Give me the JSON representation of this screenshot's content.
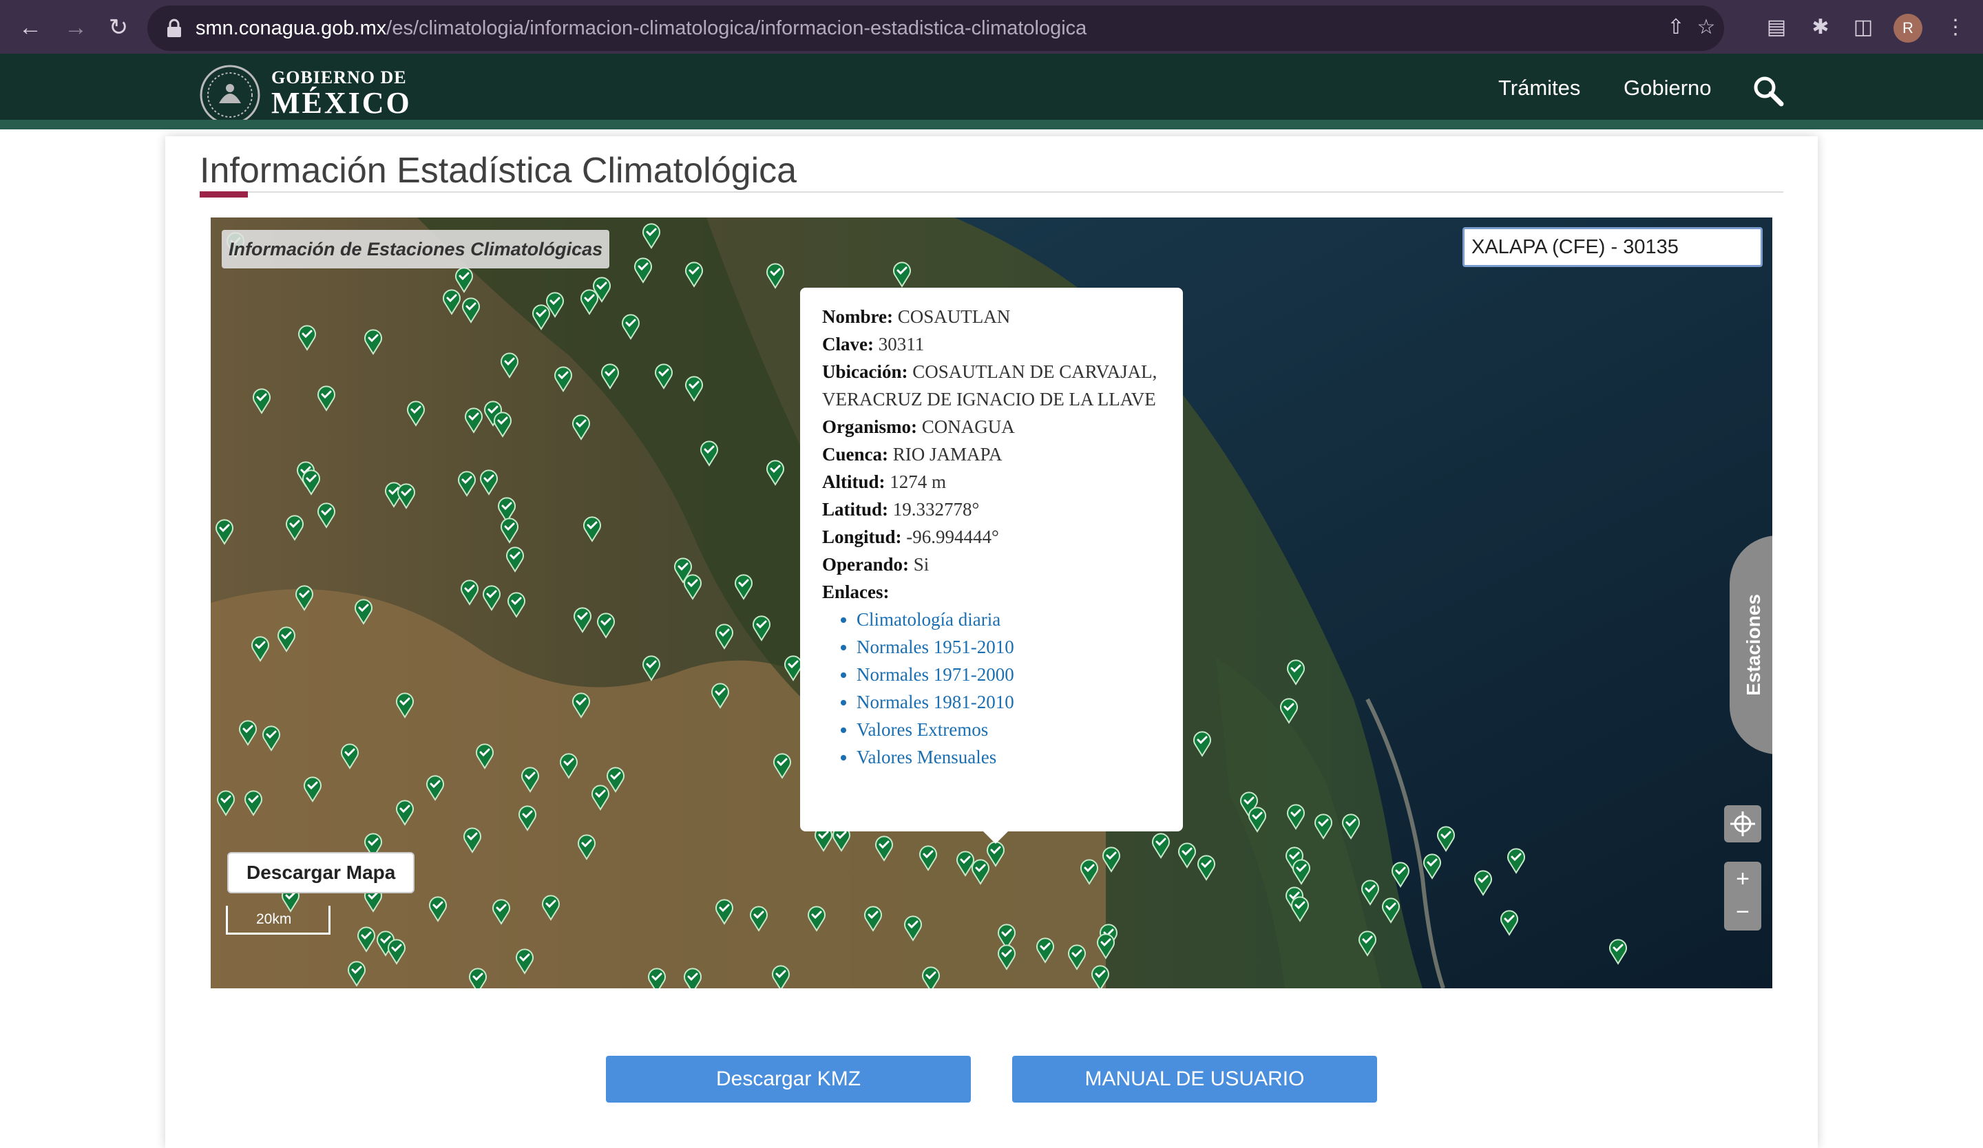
{
  "browser": {
    "url_host": "smn.conagua.gob.mx",
    "url_path": "/es/climatologia/informacion-climatologica/informacion-estadistica-climatologica",
    "profile_initial": "R"
  },
  "header": {
    "logo_line1": "GOBIERNO DE",
    "logo_line2": "MÉXICO",
    "nav": [
      "Trámites",
      "Gobierno"
    ]
  },
  "page": {
    "title": "Información Estadística Climatológica"
  },
  "map": {
    "label": "Información de Estaciones Climatológicas",
    "search_value": "XALAPA (CFE) - 30135",
    "side_tab": "Estaciones",
    "download_map": "Descargar Mapa",
    "scale": "20km",
    "zoom_in": "+",
    "zoom_out": "−",
    "popup": {
      "fields": [
        {
          "label": "Nombre:",
          "value": "COSAUTLAN"
        },
        {
          "label": "Clave:",
          "value": "30311"
        },
        {
          "label": "Ubicación:",
          "value": "COSAUTLAN DE CARVAJAL, VERACRUZ DE IGNACIO DE LA LLAVE"
        },
        {
          "label": "Organismo:",
          "value": "CONAGUA"
        },
        {
          "label": "Cuenca:",
          "value": "RIO JAMAPA"
        },
        {
          "label": "Altitud:",
          "value": "1274 m"
        },
        {
          "label": "Latitud:",
          "value": "19.332778°"
        },
        {
          "label": "Longitud:",
          "value": "-96.994444°"
        },
        {
          "label": "Operando:",
          "value": "Si"
        }
      ],
      "links_label": "Enlaces:",
      "links": [
        "Climatología diaria",
        "Normales 1951-2010",
        "Normales 1971-2000",
        "Normales 1981-2010",
        "Valores Extremos",
        "Valores Mensuales"
      ]
    }
  },
  "buttons": {
    "kmz": "Descargar KMZ",
    "manual": "MANUAL DE USUARIO"
  },
  "colors": {
    "gov_green": "#13322b",
    "accent": "#9d2449",
    "button_blue": "#4a8fdd",
    "marker_green": "#0f7a3a",
    "link_blue": "#1a6fb3"
  }
}
